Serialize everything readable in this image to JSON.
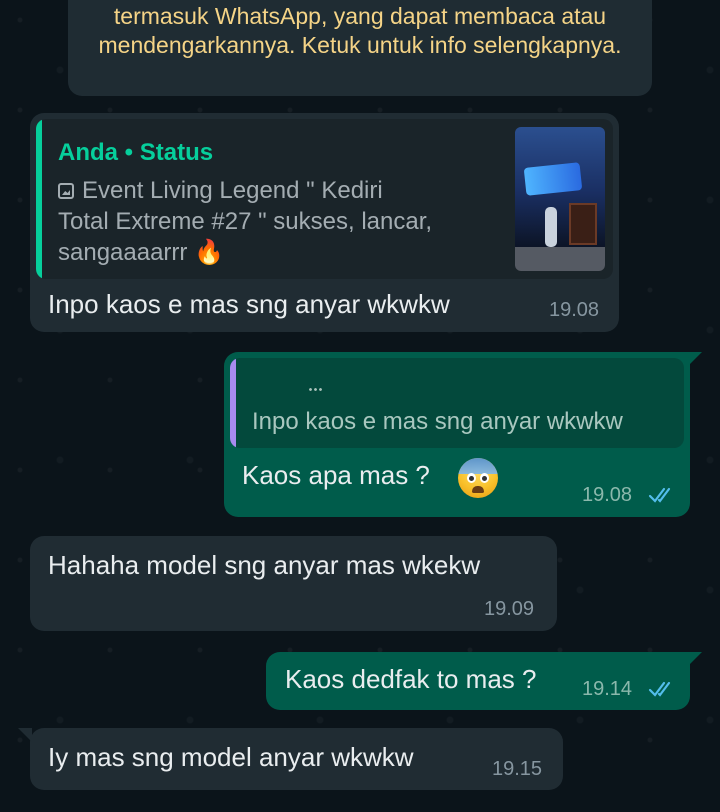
{
  "notice": {
    "text": "termasuk WhatsApp, yang dapat membaca atau mendengarkannya. Ketuk untuk info selengkapnya."
  },
  "messages": [
    {
      "direction": "incoming",
      "quoted_author": "Anda • Status",
      "quoted_text": "Event Living Legend \" Kediri Total Extreme #27 \" sukses, lancar, sangaaaarrr 🔥",
      "text": "Inpo kaos e mas sng anyar wkwkw",
      "time": "19.08"
    },
    {
      "direction": "outgoing",
      "quoted_text": "Inpo kaos e mas sng anyar wkwkw",
      "text": "Kaos apa mas ?",
      "emoji": "anxious-face",
      "time": "19.08",
      "status": "read"
    },
    {
      "direction": "incoming",
      "text": "Hahaha model sng anyar mas wkekw",
      "time": "19.09"
    },
    {
      "direction": "outgoing",
      "text": "Kaos dedfak to mas ?",
      "time": "19.14",
      "status": "read"
    },
    {
      "direction": "incoming",
      "text": "Iy mas sng model anyar wkwkw",
      "time": "19.15"
    }
  ],
  "colors": {
    "background": "#0b141a",
    "incoming_bubble": "#202c33",
    "outgoing_bubble": "#005c4b",
    "accent_green": "#06cf9c",
    "read_ticks": "#53bdeb",
    "notice_text": "#f5d487"
  }
}
